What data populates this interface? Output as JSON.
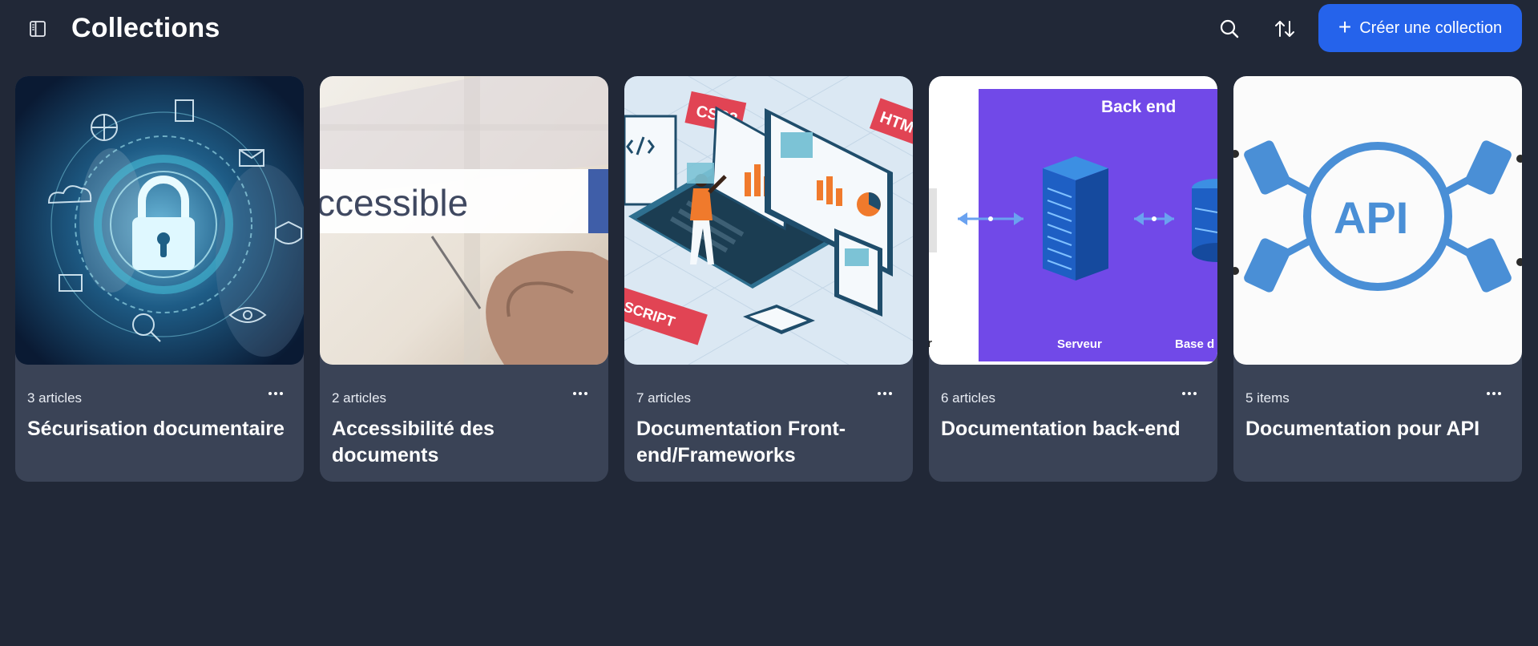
{
  "header": {
    "title": "Collections",
    "create_label": "Créer une collection",
    "icons": {
      "sidebar": "sidebar-toggle-icon",
      "search": "search-icon",
      "sort": "sort-arrows-icon",
      "create": "plus-icon"
    }
  },
  "colors": {
    "background": "#212837",
    "card": "#3a4356",
    "accent": "#2563eb"
  },
  "collections": [
    {
      "count": "3 articles",
      "title": "Sécurisation documentaire",
      "image": "security-lock-illustration"
    },
    {
      "count": "2 articles",
      "title": "Accessibilité des documents",
      "image": "accessible-search-bar-photo",
      "image_text": "ccessible"
    },
    {
      "count": "7 articles",
      "title": "Documentation Front-end/Frameworks",
      "image": "frontend-isometric-illustration",
      "image_text": [
        "CSS3",
        "HTM",
        "VASCRIPT"
      ]
    },
    {
      "count": "6 articles",
      "title": "Documentation back-end",
      "image": "backend-server-illustration",
      "image_text": [
        "Back end",
        "Serveur",
        "Base d",
        "r"
      ]
    },
    {
      "count": "5 items",
      "title": "Documentation pour API",
      "image": "api-connectors-illustration",
      "image_text": "API"
    }
  ]
}
